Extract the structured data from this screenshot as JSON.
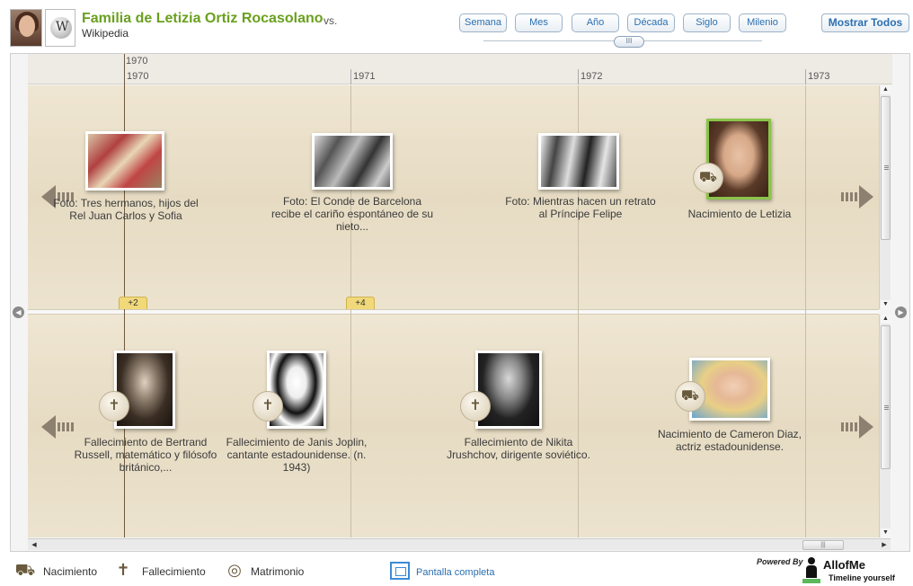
{
  "header": {
    "title": "Familia de Letizia Ortiz Rocasolano",
    "vs": "vs.",
    "subtitle": "Wikipedia",
    "wiki_logo_letter": "W"
  },
  "zoom": {
    "buttons": [
      "Semana",
      "Mes",
      "Año",
      "Década",
      "Siglo",
      "Milenio"
    ],
    "handle_label": "III",
    "show_all": "Mostrar Todos"
  },
  "ruler": {
    "decade": "1970",
    "years": [
      "1970",
      "1971",
      "1972",
      "1973"
    ]
  },
  "top_lane": {
    "counts": [
      "+2",
      "+4"
    ],
    "events": [
      {
        "label": "Foto: Tres hermanos, hijos del Rel Juan Carlos y Sofia",
        "icon": "photo"
      },
      {
        "label": "Foto: El Conde de Barcelona recibe el cariño espontáneo de su nieto...",
        "icon": "photo"
      },
      {
        "label": "Foto: Mientras hacen un retrato al Príncipe Felipe",
        "icon": "photo"
      },
      {
        "label": "Nacimiento de Letizia",
        "icon": "stroller-icon",
        "selected": true
      }
    ]
  },
  "bottom_lane": {
    "events": [
      {
        "label": "Fallecimiento de Bertrand Russell, matemático y filósofo británico,...",
        "icon": "tombstone-icon"
      },
      {
        "label": "Fallecimiento de Janis Joplin, cantante estadounidense. (n. 1943)",
        "icon": "tombstone-icon"
      },
      {
        "label": "Fallecimiento de Nikita Jrushchov, dirigente soviético.",
        "icon": "tombstone-icon"
      },
      {
        "label": "Nacimiento de Cameron Diaz, actriz estadounidense.",
        "icon": "stroller-icon"
      }
    ]
  },
  "legend": {
    "items": [
      {
        "label": "Nacimiento",
        "icon": "stroller-icon"
      },
      {
        "label": "Fallecimiento",
        "icon": "tombstone-icon"
      },
      {
        "label": "Matrimonio",
        "icon": "rings-icon"
      }
    ],
    "fullscreen": "Pantalla completa"
  },
  "branding": {
    "powered_by": "Powered By",
    "name": "AllofMe",
    "tagline": "Timeline yourself"
  },
  "colors": {
    "title_green": "#6aa01e",
    "link_blue": "#2a6fb0",
    "lane_beige": "#e6dbc2",
    "selected_border": "#8bc34a"
  }
}
